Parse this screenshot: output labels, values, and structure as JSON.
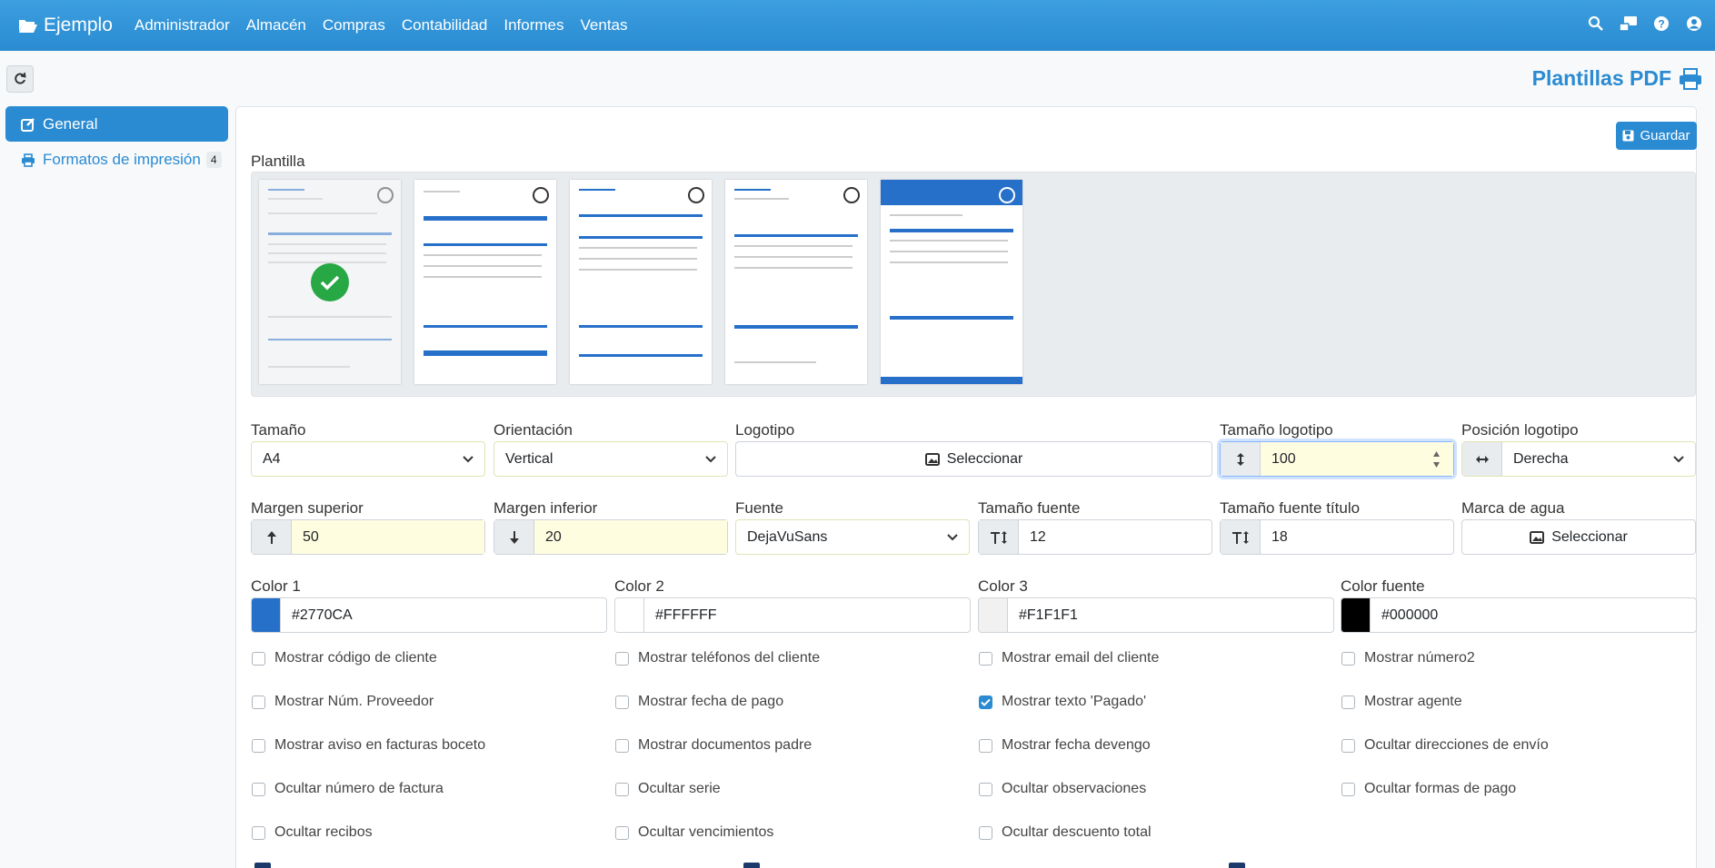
{
  "navbar": {
    "brand": "Ejemplo",
    "menu": [
      "Administrador",
      "Almacén",
      "Compras",
      "Contabilidad",
      "Informes",
      "Ventas"
    ]
  },
  "page": {
    "title": "Plantillas PDF"
  },
  "sidebar": {
    "general": "General",
    "formats": "Formatos de impresión",
    "formats_count": "4"
  },
  "toolbar": {
    "save": "Guardar"
  },
  "template": {
    "label": "Plantilla"
  },
  "row1": {
    "size_label": "Tamaño",
    "size_value": "A4",
    "orientation_label": "Orientación",
    "orientation_value": "Vertical",
    "logo_label": "Logotipo",
    "logo_button": "Seleccionar",
    "logo_size_label": "Tamaño logotipo",
    "logo_size_value": "100",
    "logo_position_label": "Posición logotipo",
    "logo_position_value": "Derecha"
  },
  "row2": {
    "margin_top_label": "Margen superior",
    "margin_top_value": "50",
    "margin_bottom_label": "Margen inferior",
    "margin_bottom_value": "20",
    "font_label": "Fuente",
    "font_value": "DejaVuSans",
    "font_size_label": "Tamaño fuente",
    "font_size_value": "12",
    "title_size_label": "Tamaño fuente título",
    "title_size_value": "18",
    "watermark_label": "Marca de agua",
    "watermark_button": "Seleccionar"
  },
  "colors": [
    {
      "label": "Color 1",
      "value": "#2770CA",
      "swatch": "#2770CA"
    },
    {
      "label": "Color 2",
      "value": "#FFFFFF",
      "swatch": "#FFFFFF"
    },
    {
      "label": "Color 3",
      "value": "#F1F1F1",
      "swatch": "#F1F1F1"
    },
    {
      "label": "Color fuente",
      "value": "#000000",
      "swatch": "#000000"
    }
  ],
  "checkboxes": [
    {
      "label": "Mostrar código de cliente",
      "checked": false
    },
    {
      "label": "Mostrar teléfonos del cliente",
      "checked": false
    },
    {
      "label": "Mostrar email del cliente",
      "checked": false
    },
    {
      "label": "Mostrar número2",
      "checked": false
    },
    {
      "label": "Mostrar Núm. Proveedor",
      "checked": false
    },
    {
      "label": "Mostrar fecha de pago",
      "checked": false
    },
    {
      "label": "Mostrar texto 'Pagado'",
      "checked": true
    },
    {
      "label": "Mostrar agente",
      "checked": false
    },
    {
      "label": "Mostrar aviso en facturas boceto",
      "checked": false
    },
    {
      "label": "Mostrar documentos padre",
      "checked": false
    },
    {
      "label": "Mostrar fecha devengo",
      "checked": false
    },
    {
      "label": "Ocultar direcciones de envío",
      "checked": false
    },
    {
      "label": "Ocultar número de factura",
      "checked": false
    },
    {
      "label": "Ocultar serie",
      "checked": false
    },
    {
      "label": "Ocultar observaciones",
      "checked": false
    },
    {
      "label": "Ocultar formas de pago",
      "checked": false
    },
    {
      "label": "Ocultar recibos",
      "checked": false
    },
    {
      "label": "Ocultar vencimientos",
      "checked": false
    },
    {
      "label": "Ocultar descuento total",
      "checked": false
    }
  ]
}
